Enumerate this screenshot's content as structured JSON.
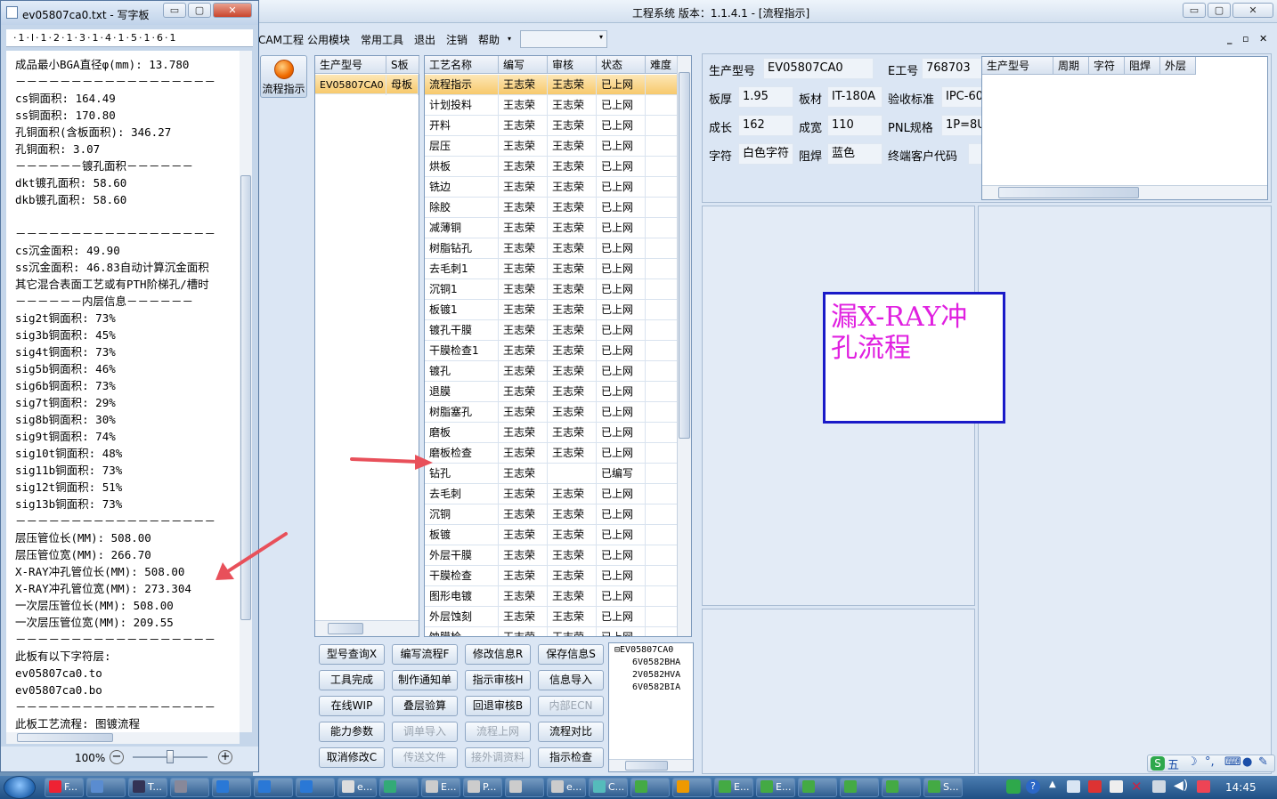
{
  "app": {
    "title": "工程系统    版本：1.1.4.1 - [流程指示]",
    "caption_buttons": [
      "▭",
      "▢",
      "✕"
    ],
    "menu": [
      "CAM工程",
      "公用模块",
      "常用工具",
      "退出",
      "注销",
      "帮助"
    ],
    "menu_dropdown": "▾",
    "mdi_buttons": [
      "_",
      "▫",
      "✕"
    ],
    "nav_button": "流程指示",
    "model_grid": {
      "headers": [
        "生产型号",
        "S板"
      ],
      "rows": [
        [
          "EV05807CA0",
          "母板"
        ]
      ]
    },
    "process_grid": {
      "headers": [
        "工艺名称",
        "编写",
        "审核",
        "状态",
        "难度"
      ],
      "rows": [
        [
          "流程指示",
          "王志荣",
          "王志荣",
          "已上网",
          ""
        ],
        [
          "计划投料",
          "王志荣",
          "王志荣",
          "已上网",
          ""
        ],
        [
          "开料",
          "王志荣",
          "王志荣",
          "已上网",
          ""
        ],
        [
          "层压",
          "王志荣",
          "王志荣",
          "已上网",
          ""
        ],
        [
          "烘板",
          "王志荣",
          "王志荣",
          "已上网",
          ""
        ],
        [
          "铣边",
          "王志荣",
          "王志荣",
          "已上网",
          ""
        ],
        [
          "除胶",
          "王志荣",
          "王志荣",
          "已上网",
          ""
        ],
        [
          "减薄铜",
          "王志荣",
          "王志荣",
          "已上网",
          ""
        ],
        [
          "树脂钻孔",
          "王志荣",
          "王志荣",
          "已上网",
          ""
        ],
        [
          "去毛刺1",
          "王志荣",
          "王志荣",
          "已上网",
          ""
        ],
        [
          "沉铜1",
          "王志荣",
          "王志荣",
          "已上网",
          ""
        ],
        [
          "板镀1",
          "王志荣",
          "王志荣",
          "已上网",
          ""
        ],
        [
          "镀孔干膜",
          "王志荣",
          "王志荣",
          "已上网",
          ""
        ],
        [
          "干膜检查1",
          "王志荣",
          "王志荣",
          "已上网",
          ""
        ],
        [
          "镀孔",
          "王志荣",
          "王志荣",
          "已上网",
          ""
        ],
        [
          "退膜",
          "王志荣",
          "王志荣",
          "已上网",
          ""
        ],
        [
          "树脂塞孔",
          "王志荣",
          "王志荣",
          "已上网",
          ""
        ],
        [
          "磨板",
          "王志荣",
          "王志荣",
          "已上网",
          ""
        ],
        [
          "磨板检查",
          "王志荣",
          "王志荣",
          "已上网",
          ""
        ],
        [
          "钻孔",
          "王志荣",
          "",
          "已编写",
          ""
        ],
        [
          "去毛刺",
          "王志荣",
          "王志荣",
          "已上网",
          ""
        ],
        [
          "沉铜",
          "王志荣",
          "王志荣",
          "已上网",
          ""
        ],
        [
          "板镀",
          "王志荣",
          "王志荣",
          "已上网",
          ""
        ],
        [
          "外层干膜",
          "王志荣",
          "王志荣",
          "已上网",
          ""
        ],
        [
          "干膜检查",
          "王志荣",
          "王志荣",
          "已上网",
          ""
        ],
        [
          "图形电镀",
          "王志荣",
          "王志荣",
          "已上网",
          ""
        ],
        [
          "外层蚀刻",
          "王志荣",
          "王志荣",
          "已上网",
          ""
        ],
        [
          "蚀膜检",
          "王志荣",
          "王志荣",
          "已上网",
          ""
        ]
      ]
    },
    "buttons": [
      [
        "型号查询X",
        "编写流程F",
        "修改信息R",
        "保存信息S"
      ],
      [
        "工具完成",
        "制作通知单",
        "指示审核H",
        "信息导入"
      ],
      [
        "在线WIP",
        "叠层验算",
        "回退审核B",
        "内部ECN"
      ],
      [
        "能力参数",
        "调单导入",
        "流程上网",
        "流程对比"
      ],
      [
        "取消修改C",
        "传送文件",
        "接外调资料",
        "指示检查"
      ]
    ],
    "disabled_buttons": [
      "内部ECN",
      "调单导入",
      "流程上网",
      "传送文件",
      "接外调资料"
    ],
    "tree": {
      "root": "EV05807CA0",
      "children": [
        "6V0582BHA",
        "2V0582HVA",
        "6V0582BIA"
      ]
    },
    "info": {
      "labels": [
        "生产型号",
        "E工号",
        "板厚",
        "板材",
        "验收标准",
        "成长",
        "成宽",
        "PNL规格",
        "字符",
        "阻焊",
        "终端客户代码"
      ],
      "values": {
        "model": "EV05807CA0",
        "eno": "768703",
        "thickness": "1.95",
        "material": "IT-180A",
        "standard": "IPC-60",
        "length": "162",
        "width": "110",
        "pnl": "1P=8U",
        "char": "白色字符",
        "mask": "蓝色",
        "customer": ""
      }
    },
    "side_headers": [
      "生产型号",
      "周期",
      "字符",
      "阻焊",
      "外层"
    ],
    "note_text": "漏X-RAY冲孔流程"
  },
  "wordpad": {
    "title": "ev05807ca0.txt - 写字板",
    "ruler": "·1·l·1·2·1·3·1·4·1·5·1·6·1",
    "lines": [
      "成品最小BGA直径φ(mm): 13.780",
      "－－－－－－－－－－－－－－－－－－",
      "cs铜面积: 164.49",
      "ss铜面积: 170.80",
      "孔铜面积(含板面积): 346.27",
      "孔铜面积: 3.07",
      "－－－－－－镀孔面积－－－－－－",
      "dkt镀孔面积: 58.60",
      "dkb镀孔面积: 58.60",
      "",
      "－－－－－－－－－－－－－－－－－－",
      "cs沉金面积: 49.90",
      "ss沉金面积: 46.83自动计算沉金面积",
      "其它混合表面工艺或有PTH阶梯孔/槽时",
      "－－－－－－内层信息－－－－－－",
      "sig2t铜面积: 73%",
      "sig3b铜面积: 45%",
      "sig4t铜面积: 73%",
      "sig5b铜面积: 46%",
      "sig6b铜面积: 73%",
      "sig7t铜面积: 29%",
      "sig8b铜面积: 30%",
      "sig9t铜面积: 74%",
      "sig10t铜面积: 48%",
      "sig11b铜面积: 73%",
      "sig12t铜面积: 51%",
      "sig13b铜面积: 73%",
      "－－－－－－－－－－－－－－－－－－",
      "层压管位长(MM): 508.00",
      "层压管位宽(MM): 266.70",
      "X-RAY冲孔管位长(MM): 508.00",
      "X-RAY冲孔管位宽(MM): 273.304",
      "一次层压管位长(MM): 508.00",
      "一次层压管位宽(MM): 209.55",
      "－－－－－－－－－－－－－－－－－－",
      "此板有以下字符层:",
      "ev05807ca0.to",
      "ev05807ca0.bo",
      "－－－－－－－－－－－－－－－－－－",
      "此板工艺流程: 图镀流程"
    ],
    "zoom": "100%",
    "zoom_minus": "−",
    "zoom_plus": "+"
  },
  "taskbar": {
    "items": [
      "F...",
      "",
      "T...",
      "",
      "",
      "",
      "",
      "e...",
      "",
      "E...",
      "P...",
      "",
      "e...",
      "C...",
      "",
      "",
      "E...",
      "E...",
      "",
      "",
      "",
      "S..."
    ],
    "ime": "五",
    "clock": "14:45"
  },
  "colors": {
    "accent": "#f7c96c",
    "note_border": "#1a1ac8",
    "note_text": "#e020e0",
    "arrow": "#e8505a"
  }
}
